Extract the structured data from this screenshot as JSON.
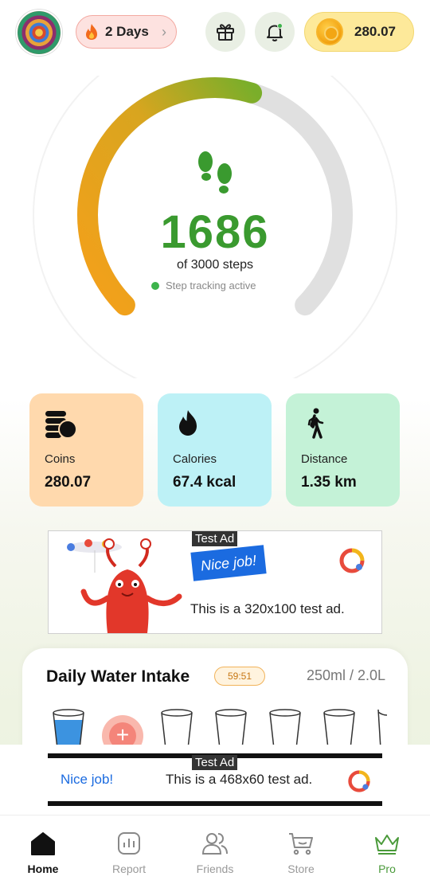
{
  "header": {
    "streak_label": "2 Days",
    "coin_balance": "280.07"
  },
  "steps": {
    "current": "1686",
    "goal_text": "of 3000 steps",
    "status_text": "Step tracking active",
    "progress_fraction": 0.562
  },
  "stats": [
    {
      "label": "Coins",
      "value": "280.07",
      "icon": "coins-stack-icon",
      "bg": "#ffd9ad"
    },
    {
      "label": "Calories",
      "value": "67.4 kcal",
      "icon": "flame-icon",
      "bg": "#bdf1f6"
    },
    {
      "label": "Distance",
      "value": "1.35 km",
      "icon": "walking-person-icon",
      "bg": "#c4f2d7"
    }
  ],
  "ad_top": {
    "tag": "Test Ad",
    "badge": "Nice job!",
    "text": "This is a 320x100 test ad."
  },
  "water": {
    "title": "Daily Water Intake",
    "timer": "59:51",
    "amount": "250ml / 2.0L"
  },
  "ad_bottom": {
    "tag": "Test Ad",
    "badge": "Nice job!",
    "text": "This is a 468x60 test ad."
  },
  "nav": {
    "home": "Home",
    "report": "Report",
    "friends": "Friends",
    "store": "Store",
    "pro": "Pro"
  },
  "colors": {
    "accent_green": "#3a9a2f",
    "gauge_start": "#f5a01a",
    "gauge_end": "#7aae2a"
  }
}
